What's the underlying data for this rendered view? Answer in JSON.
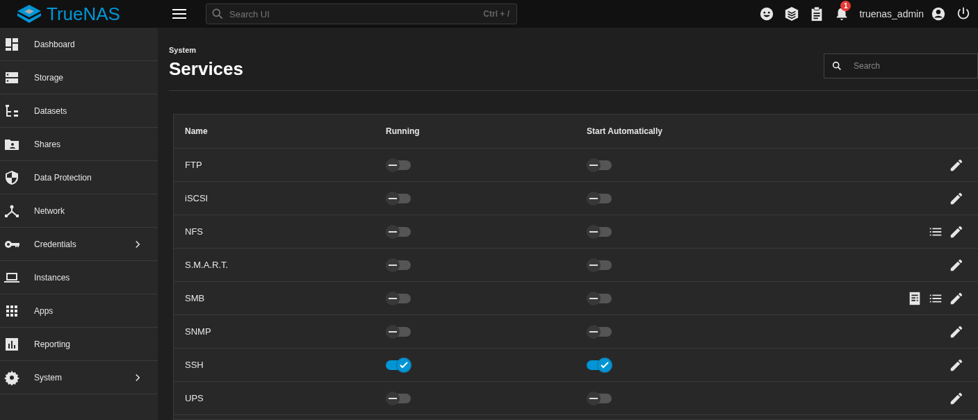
{
  "brand": {
    "name": "TrueNAS"
  },
  "search_ui": {
    "placeholder": "Search UI",
    "shortcut": "Ctrl + /"
  },
  "topbar": {
    "notification_count": "1",
    "username": "truenas_admin"
  },
  "sidebar": {
    "items": [
      {
        "label": "Dashboard",
        "has_submenu": false
      },
      {
        "label": "Storage",
        "has_submenu": false
      },
      {
        "label": "Datasets",
        "has_submenu": false
      },
      {
        "label": "Shares",
        "has_submenu": false
      },
      {
        "label": "Data Protection",
        "has_submenu": false
      },
      {
        "label": "Network",
        "has_submenu": false
      },
      {
        "label": "Credentials",
        "has_submenu": true
      },
      {
        "label": "Instances",
        "has_submenu": false
      },
      {
        "label": "Apps",
        "has_submenu": false
      },
      {
        "label": "Reporting",
        "has_submenu": false
      },
      {
        "label": "System",
        "has_submenu": true
      }
    ]
  },
  "page": {
    "breadcrumb": "System",
    "title": "Services",
    "search": {
      "placeholder": "Search"
    }
  },
  "table": {
    "columns": [
      "Name",
      "Running",
      "Start Automatically"
    ],
    "rows": [
      {
        "name": "FTP",
        "running": false,
        "start_automatically": false,
        "actions": [
          {
            "kind": "edit"
          }
        ]
      },
      {
        "name": "iSCSI",
        "running": false,
        "start_automatically": false,
        "actions": [
          {
            "kind": "edit"
          }
        ]
      },
      {
        "name": "NFS",
        "running": false,
        "start_automatically": false,
        "actions": [
          {
            "kind": "list"
          },
          {
            "kind": "edit"
          }
        ]
      },
      {
        "name": "S.M.A.R.T.",
        "running": false,
        "start_automatically": false,
        "actions": [
          {
            "kind": "edit"
          }
        ]
      },
      {
        "name": "SMB",
        "running": false,
        "start_automatically": false,
        "actions": [
          {
            "kind": "logs"
          },
          {
            "kind": "list"
          },
          {
            "kind": "edit"
          }
        ]
      },
      {
        "name": "SNMP",
        "running": false,
        "start_automatically": false,
        "actions": [
          {
            "kind": "edit"
          }
        ]
      },
      {
        "name": "SSH",
        "running": true,
        "start_automatically": true,
        "actions": [
          {
            "kind": "edit"
          }
        ]
      },
      {
        "name": "UPS",
        "running": false,
        "start_automatically": false,
        "actions": [
          {
            "kind": "edit"
          }
        ]
      }
    ]
  }
}
